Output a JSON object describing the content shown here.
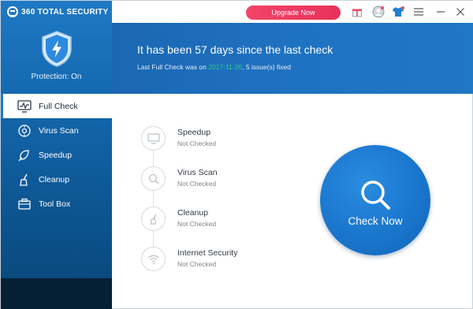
{
  "app": {
    "brand": "360 TOTAL SECURITY"
  },
  "sidebar": {
    "protection_status": "Protection: On",
    "items": [
      {
        "label": "Full Check",
        "icon": "full-check-icon",
        "active": true
      },
      {
        "label": "Virus Scan",
        "icon": "virus-scan-icon",
        "active": false
      },
      {
        "label": "Speedup",
        "icon": "speedup-icon",
        "active": false
      },
      {
        "label": "Cleanup",
        "icon": "cleanup-icon",
        "active": false
      },
      {
        "label": "Tool Box",
        "icon": "toolbox-icon",
        "active": false
      }
    ]
  },
  "topbar": {
    "upgrade_label": "Upgrade Now",
    "icons": [
      "gift-icon",
      "user-icon",
      "skin-icon",
      "menu-icon",
      "minimize-icon",
      "close-icon"
    ]
  },
  "header": {
    "title": "It has been 57 days since the last check",
    "subtitle_prefix": "Last Full Check was on",
    "subtitle_date": "2017-11-26",
    "subtitle_suffix": ", 5 issue(s) fixed"
  },
  "checks": [
    {
      "title": "Speedup",
      "status": "Not Checked",
      "icon": "monitor-icon"
    },
    {
      "title": "Virus Scan",
      "status": "Not Checked",
      "icon": "search-icon"
    },
    {
      "title": "Cleanup",
      "status": "Not Checked",
      "icon": "broom-icon"
    },
    {
      "title": "Internet Security",
      "status": "Not Checked",
      "icon": "wifi-icon"
    }
  ],
  "check_now": {
    "label": "Check Now"
  },
  "colors": {
    "accent": "#1f72c1",
    "upgrade": "#ec3a62",
    "date": "#2bd07a"
  }
}
